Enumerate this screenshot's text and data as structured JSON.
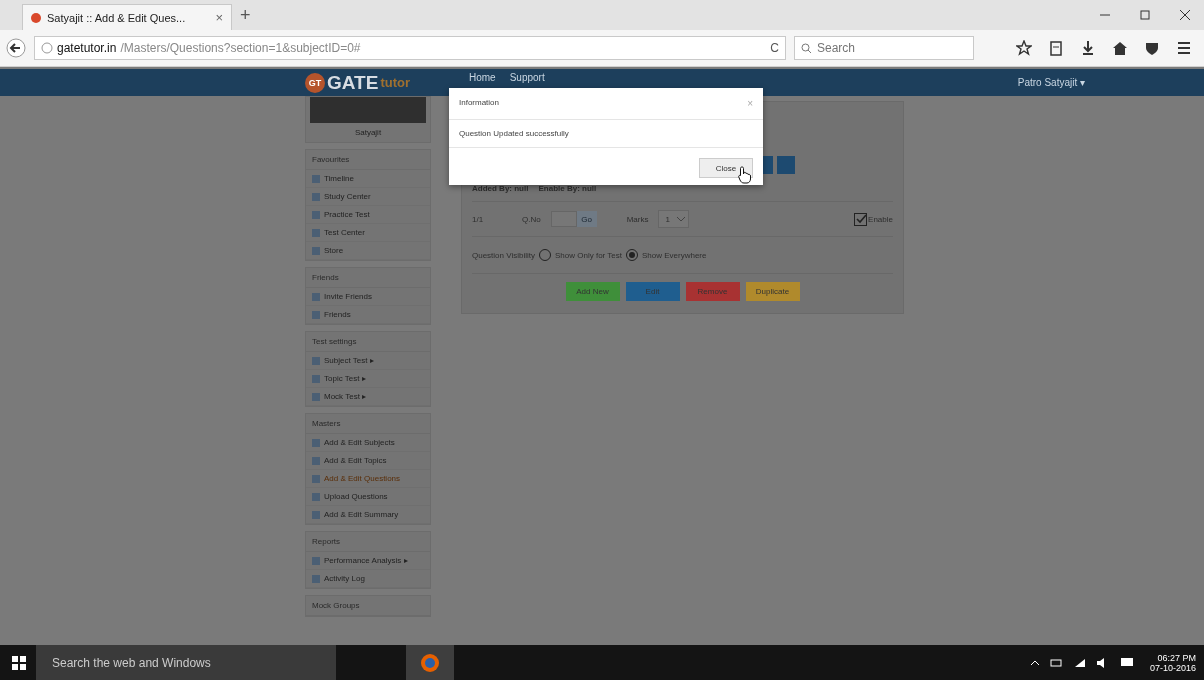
{
  "browser": {
    "tab_title": "Satyajit :: Add & Edit Ques...",
    "tab_close": "×",
    "new_tab": "+",
    "url_host": "gatetutor.in",
    "url_path": "/Masters/Questions?section=1&subjectID=0#",
    "reload": "C",
    "search_placeholder": "Search"
  },
  "site": {
    "logo_badge": "GT",
    "logo_main": "GATE",
    "logo_sub": "tutor",
    "nav": [
      "Home",
      "Support"
    ],
    "user": "Patro Satyajit ▾"
  },
  "sidebar": {
    "profile_name": "Satyajit",
    "sections": [
      {
        "title": "Favourites",
        "items": [
          {
            "label": "Timeline",
            "selected": false
          },
          {
            "label": "Study Center",
            "selected": false
          },
          {
            "label": "Practice Test",
            "selected": false
          },
          {
            "label": "Test Center",
            "selected": false
          },
          {
            "label": "Store",
            "selected": false
          }
        ]
      },
      {
        "title": "Friends",
        "items": [
          {
            "label": "Invite Friends",
            "selected": false
          },
          {
            "label": "Friends",
            "selected": false
          }
        ]
      },
      {
        "title": "Test settings",
        "items": [
          {
            "label": "Subject Test ▸",
            "selected": false
          },
          {
            "label": "Topic Test ▸",
            "selected": false
          },
          {
            "label": "Mock Test ▸",
            "selected": false
          }
        ]
      },
      {
        "title": "Masters",
        "items": [
          {
            "label": "Add & Edit Subjects",
            "selected": false
          },
          {
            "label": "Add & Edit Topics",
            "selected": false
          },
          {
            "label": "Add & Edit Questions",
            "selected": true
          },
          {
            "label": "Upload Questions",
            "selected": false
          },
          {
            "label": "Add & Edit Summary",
            "selected": false
          }
        ]
      },
      {
        "title": "Reports",
        "items": [
          {
            "label": "Performance Analysis ▸",
            "selected": false
          },
          {
            "label": "Activity Log",
            "selected": false
          }
        ]
      },
      {
        "title": "Mock Groups"
      }
    ]
  },
  "form": {
    "added_by": "Added By: null",
    "enable_by": "Enable By: null",
    "count": "1/1",
    "qno_label": "Q.No",
    "go": "Go",
    "marks_label": "Marks",
    "marks_value": "1",
    "enable": {
      "label": "Enable",
      "checked": true
    },
    "visibility": {
      "label": "Question Visibility",
      "options": [
        {
          "label": "Show Only for Test",
          "selected": false
        },
        {
          "label": "Show Everywhere",
          "selected": true
        }
      ]
    },
    "buttons": [
      {
        "label": "Add New",
        "color": "#3f8f3a"
      },
      {
        "label": "Edit",
        "color": "#1f5e8f"
      },
      {
        "label": "Remove",
        "color": "#a83232"
      },
      {
        "label": "Duplicate",
        "color": "#b08a2c"
      }
    ]
  },
  "modal": {
    "title": "Information",
    "close": "×",
    "message": "Question Updated successfully",
    "button": "Close"
  },
  "taskbar": {
    "search_placeholder": "Search the web and Windows",
    "time": "06:27 PM",
    "date": "07-10-2016"
  }
}
